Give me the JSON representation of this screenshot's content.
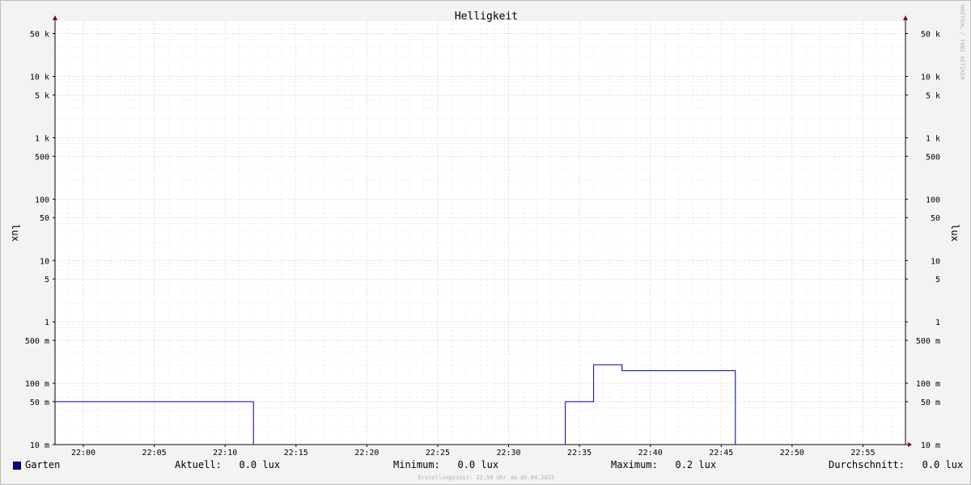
{
  "chart_data": {
    "type": "line",
    "title": "Helligkeit",
    "ylabel": "lux",
    "y_scale": "log",
    "ylim": [
      0.01,
      80000
    ],
    "xlim": [
      "21:58",
      "22:58"
    ],
    "x_ticks": [
      "22:00",
      "22:05",
      "22:10",
      "22:15",
      "22:20",
      "22:25",
      "22:30",
      "22:35",
      "22:40",
      "22:45",
      "22:50",
      "22:55"
    ],
    "y_ticks": [
      {
        "value": 0.01,
        "label": "10 m"
      },
      {
        "value": 0.05,
        "label": "50 m"
      },
      {
        "value": 0.1,
        "label": "100 m"
      },
      {
        "value": 0.5,
        "label": "500 m"
      },
      {
        "value": 1,
        "label": "1"
      },
      {
        "value": 5,
        "label": "5"
      },
      {
        "value": 10,
        "label": "10"
      },
      {
        "value": 50,
        "label": "50"
      },
      {
        "value": 100,
        "label": "100"
      },
      {
        "value": 500,
        "label": "500"
      },
      {
        "value": 1000,
        "label": "1 k"
      },
      {
        "value": 5000,
        "label": "5 k"
      },
      {
        "value": 10000,
        "label": "10 k"
      },
      {
        "value": 50000,
        "label": "50 k"
      }
    ],
    "grid": true,
    "series": [
      {
        "name": "Garten",
        "color": "#0000a0",
        "points": [
          [
            "21:58",
            0.05
          ],
          [
            "22:12",
            0.05
          ],
          [
            "22:12",
            0.01
          ],
          [
            "22:34",
            0.01
          ],
          [
            "22:34",
            0.05
          ],
          [
            "22:36",
            0.05
          ],
          [
            "22:36",
            0.2
          ],
          [
            "22:38",
            0.2
          ],
          [
            "22:38",
            0.16
          ],
          [
            "22:46",
            0.16
          ],
          [
            "22:46",
            0.01
          ],
          [
            "22:58",
            0.01
          ]
        ]
      }
    ]
  },
  "watermark": "RRDTOOL / TOBI OETIKER",
  "legend": {
    "series_name": "Garten",
    "current": "Aktuell:   0.0 lux",
    "minimum": "Minimum:   0.0 lux",
    "maximum": "Maximum:   0.2 lux",
    "average": "Durchschnitt:   0.0 lux"
  },
  "footer": "Erstellungszeit: 22:58 Uhr am 05.04.2025",
  "colors": {
    "series": "#0000a0",
    "major_grid": "#f4a0a0",
    "minor_grid": "#d8d8d8",
    "axis": "#000000",
    "arrow": "#8b0000"
  }
}
